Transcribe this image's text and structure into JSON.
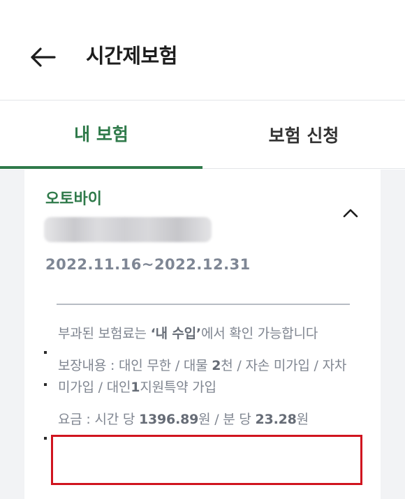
{
  "header": {
    "title": "시간제보험",
    "back_icon": "arrow-left-icon"
  },
  "tabs": [
    {
      "label": "내 보험",
      "active": true
    },
    {
      "label": "보험 신청",
      "active": false
    }
  ],
  "colors": {
    "accent": "#2f7a4a",
    "highlight": "#d0141f"
  },
  "card": {
    "vehicle_type": "오토바이",
    "period": "2022.11.16~2022.12.31",
    "expand_icon": "chevron-up-icon",
    "notes": {
      "premium": {
        "pre": "부과된 보험료는 ",
        "bold": "‘내 수입’",
        "post": "에서 확인 가능합니다"
      },
      "coverage": {
        "label": "보장내용 : ",
        "p1": "대인 무한 / 대물 ",
        "b1": "2",
        "p2": "천 / 자손 미가입 / 자차 미가입 / 대인",
        "b2": "1",
        "p3": "지원특약 가입"
      },
      "fee": {
        "label": "요금 : ",
        "p1": "시간 당 ",
        "b1": "1396.89",
        "p2": "원 / 분 당 ",
        "b2": "23.28",
        "p3": "원"
      }
    }
  }
}
